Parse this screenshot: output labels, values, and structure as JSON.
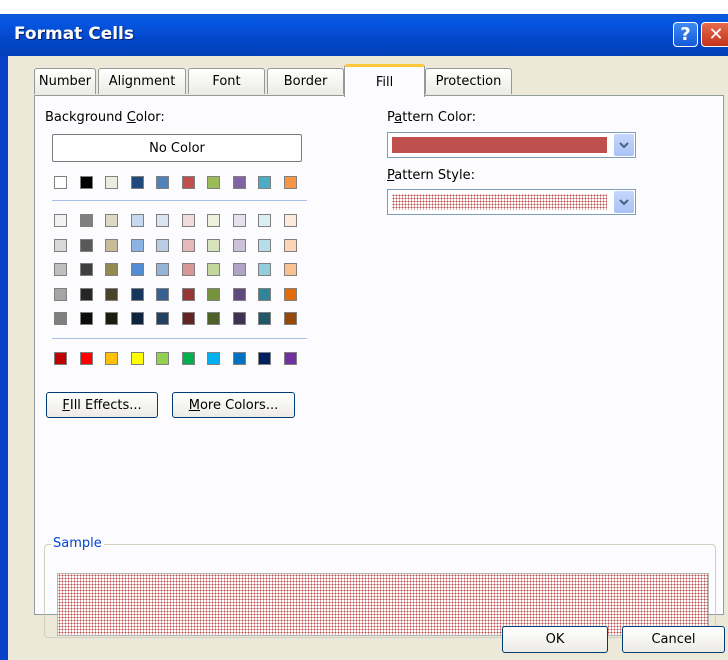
{
  "window": {
    "title": "Format Cells",
    "help_glyph": "?",
    "close_glyph": "✕"
  },
  "tabs": [
    {
      "label": "Number"
    },
    {
      "label": "Alignment"
    },
    {
      "label": "Font"
    },
    {
      "label": "Border"
    },
    {
      "label": "Fill",
      "active": true
    },
    {
      "label": "Protection"
    }
  ],
  "fill": {
    "background_color_label_pre": "Background ",
    "background_color_label_u": "C",
    "background_color_label_post": "olor:",
    "no_color_label": "No Color",
    "theme_row": [
      "#ffffff",
      "#000000",
      "#eeece1",
      "#1f497d",
      "#4f81bd",
      "#c0504d",
      "#9bbb59",
      "#8064a2",
      "#4bacc6",
      "#f79646"
    ],
    "tint_rows": [
      [
        "#f2f2f2",
        "#7f7f7f",
        "#ddd9c3",
        "#c6d9f0",
        "#dbe5f1",
        "#f2dcdb",
        "#ebf1dd",
        "#e5e0ec",
        "#dbeef3",
        "#fdeada"
      ],
      [
        "#d8d8d8",
        "#595959",
        "#c4bd97",
        "#8db3e2",
        "#b8cce4",
        "#e5b9b7",
        "#d7e3bc",
        "#ccc1d9",
        "#b7dde8",
        "#fbd5b5"
      ],
      [
        "#bfbfbf",
        "#3f3f3f",
        "#938953",
        "#548dd4",
        "#95b3d7",
        "#d99694",
        "#c3d69b",
        "#b2a2c7",
        "#92cddc",
        "#fac08f"
      ],
      [
        "#a5a5a5",
        "#262626",
        "#494429",
        "#17365d",
        "#366092",
        "#953734",
        "#76923c",
        "#5f497a",
        "#31859b",
        "#e36c09"
      ],
      [
        "#7f7f7f",
        "#0c0c0c",
        "#1d1b10",
        "#0f243e",
        "#244061",
        "#632423",
        "#4f6128",
        "#3f3151",
        "#205867",
        "#974806"
      ]
    ],
    "standard_row": [
      "#c00000",
      "#ff0000",
      "#ffc000",
      "#ffff00",
      "#92d050",
      "#00b050",
      "#00b0f0",
      "#0070c0",
      "#002060",
      "#7030a0"
    ],
    "fill_effects_pre": "",
    "fill_effects_u": "I",
    "fill_effects_post": "ll Effects...",
    "fill_effects_u_first": "F",
    "more_colors_u": "M",
    "more_colors_post": "ore Colors...",
    "pattern_color_pre": "P",
    "pattern_color_u": "a",
    "pattern_color_post": "ttern Color:",
    "pattern_color_value": "#c0504d",
    "pattern_style_u": "P",
    "pattern_style_post": "attern Style:",
    "pattern_style_value": "dotted pattern",
    "sample_label": "Sample"
  },
  "footer": {
    "ok_label": "OK",
    "cancel_label": "Cancel"
  },
  "icons": {
    "dropdown": "chevron-down-icon",
    "help": "help-icon",
    "close": "close-icon"
  }
}
